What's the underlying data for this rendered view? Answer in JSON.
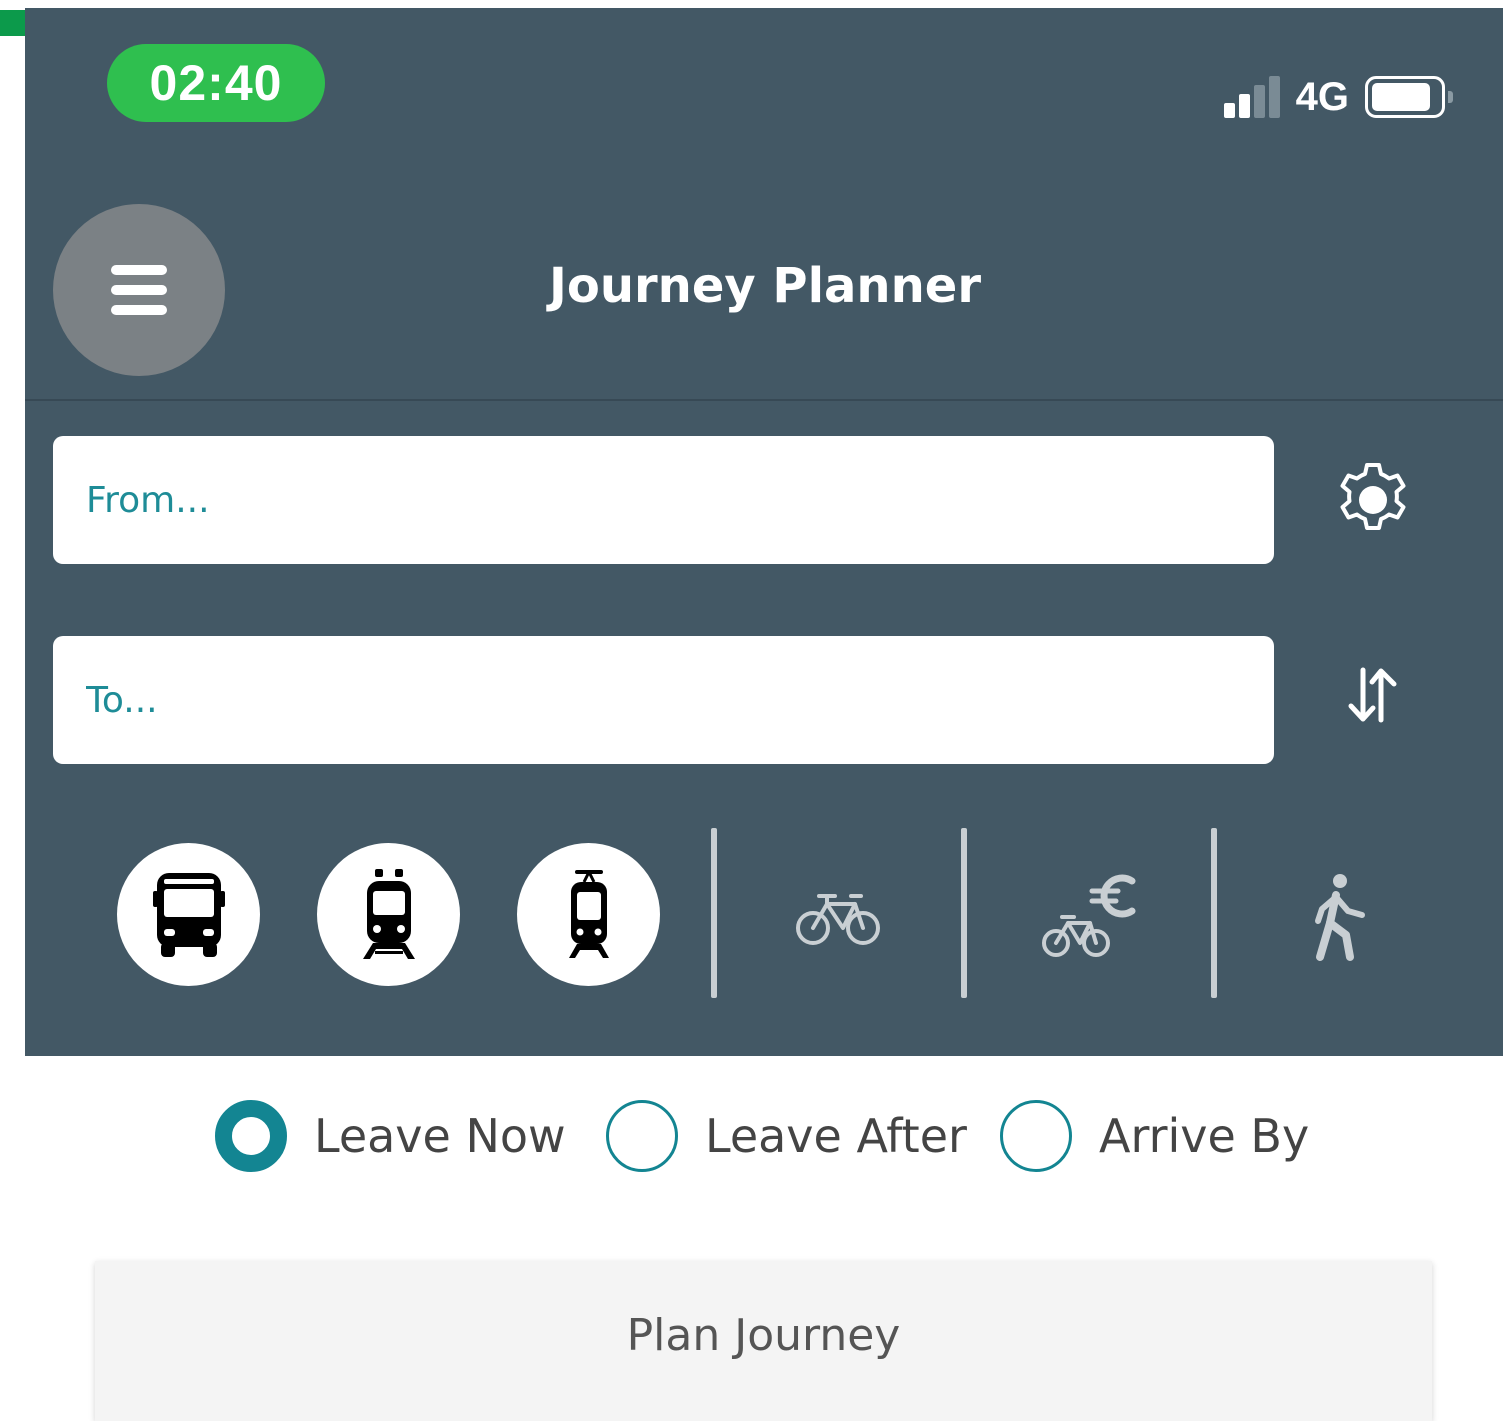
{
  "status_bar": {
    "time": "02:40",
    "network": "4G",
    "battery_level": 0.85,
    "signal_bars_active": 2,
    "signal_bars_total": 4,
    "time_pill_color": "#2fbf4f"
  },
  "header": {
    "title": "Journey Planner",
    "menu_icon": "hamburger-icon",
    "background_color": "#435865"
  },
  "search": {
    "from_placeholder": "From...",
    "from_value": "",
    "to_placeholder": "To...",
    "to_value": "",
    "settings_icon": "gear-icon",
    "swap_icon": "swap-arrows-icon",
    "accent_color": "#1e8c97"
  },
  "transport_modes": [
    {
      "id": "bus",
      "icon": "bus-icon",
      "selected": true
    },
    {
      "id": "rail",
      "icon": "train-icon",
      "selected": true
    },
    {
      "id": "tram",
      "icon": "tram-icon",
      "selected": true
    },
    {
      "id": "bike",
      "icon": "bicycle-icon",
      "selected": false
    },
    {
      "id": "bikeshare",
      "icon": "bike-share-euro-icon",
      "selected": false
    },
    {
      "id": "walk",
      "icon": "walking-person-icon",
      "selected": false
    }
  ],
  "time_options": {
    "leave_now": "Leave Now",
    "leave_after": "Leave After",
    "arrive_by": "Arrive By",
    "selected": "leave_now",
    "radio_color": "#138592"
  },
  "plan_button": {
    "label": "Plan Journey"
  }
}
